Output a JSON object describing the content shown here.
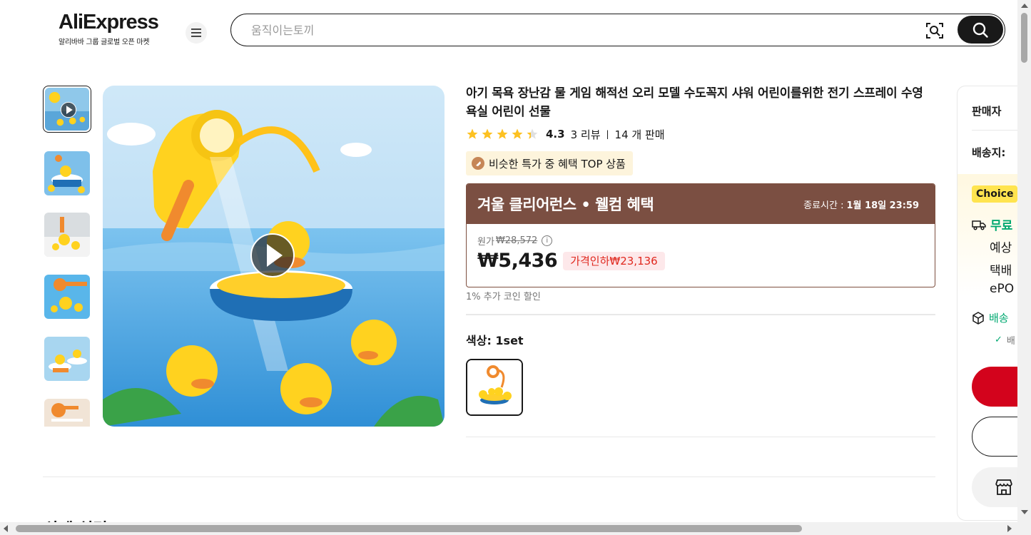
{
  "header": {
    "logo_text": "AliExpress",
    "logo_subtitle": "알리바바 그룹 글로벌 오픈 마켓",
    "search_placeholder": "움직이는토끼"
  },
  "product": {
    "title": "아기 목욕 장난감 물 게임 해적선 오리 모델 수도꼭지 샤워 어린이를위한 전기 스프레이 수영 욕실 어린이 선물",
    "rating": "4.3",
    "stars_filled": 4.3,
    "reviews": "3 리뷰",
    "sold": "14 개 판매",
    "badge": "비슷한 특가 중 혜택 TOP 상품",
    "promo_title": "겨울 클리어런스 • 웰컴 혜택",
    "promo_end_label": "종료시간 :",
    "promo_end_value": "1월 18일 23:59",
    "original_price_label": "원가",
    "original_price": "₩28,572",
    "price": "₩5,436",
    "discount": "가격인하₩23,136",
    "coin_note": "1% 추가 코인 할인",
    "color_label": "색상: 1set",
    "next_section": "상세 설명"
  },
  "side_panel": {
    "seller_label": "판매자",
    "ship_to_label": "배송지:",
    "choice_label": "Choice",
    "free_label": "무료",
    "line1": "예상",
    "line2": "택배",
    "line3": "ePO",
    "safe_label": "배송",
    "check_text": "배"
  },
  "colors": {
    "accent_red": "#d3031c",
    "promo_brown": "#7b4f42",
    "choice_yellow": "#ffe44f",
    "free_green": "#01a971",
    "star_yellow": "#fdc121"
  }
}
